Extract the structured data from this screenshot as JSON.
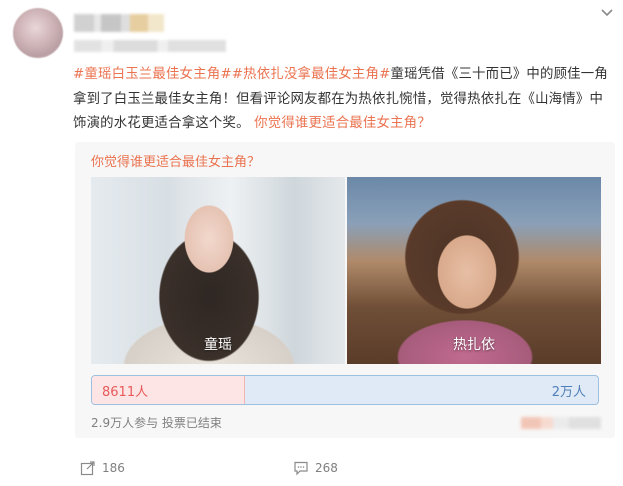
{
  "post": {
    "tags": [
      "#童瑶白玉兰最佳女主角#",
      "#热依扎没拿最佳女主角#"
    ],
    "text_main": "童瑶凭借《三十而已》中的顾佳一角拿到了白玉兰最佳女主角！但看评论网友都在为热依扎惋惜，觉得热依扎在《山海情》中饰演的水花更适合拿这个奖。",
    "text_link": "你觉得谁更适合最佳女主角？"
  },
  "poll": {
    "question": "你觉得谁更适合最佳女主角？",
    "options": [
      {
        "label": "童瑶",
        "votes": "8611人"
      },
      {
        "label": "热扎依",
        "votes": "2万人"
      }
    ],
    "left_share": 0.3,
    "footer": "2.9万人参与 投票已结束"
  },
  "actions": {
    "repost_count": "186",
    "comment_count": "268"
  },
  "colors": {
    "accent": "#eb7350",
    "bar_left": "#fde5e5",
    "bar_right": "#dfeaf6"
  },
  "icons": [
    "chevron-down-icon",
    "repost-icon",
    "comment-icon"
  ]
}
